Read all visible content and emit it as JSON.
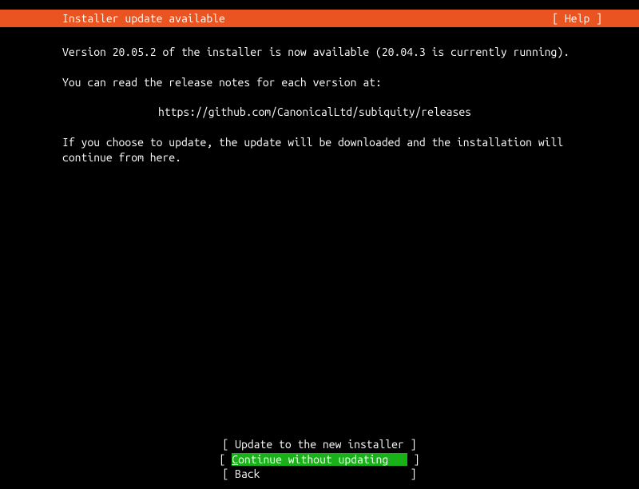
{
  "header": {
    "title": "Installer update available",
    "help": "[ Help ]"
  },
  "body": {
    "line1": "Version 20.05.2 of the installer is now available (20.04.3 is currently running).",
    "line2": "You can read the release notes for each version at:",
    "release_url": "https://github.com/CanonicalLtd/subiquity/releases",
    "line3": "If you choose to update, the update will be downloaded and the installation will continue from here."
  },
  "buttons": {
    "update": "[ Update to the new installer ]",
    "continue_prefix": "[ ",
    "continue_hotkey": "C",
    "continue_rest": "ontinue without updating   ",
    "continue_suffix": " ]",
    "back": "[ Back                        ]"
  }
}
